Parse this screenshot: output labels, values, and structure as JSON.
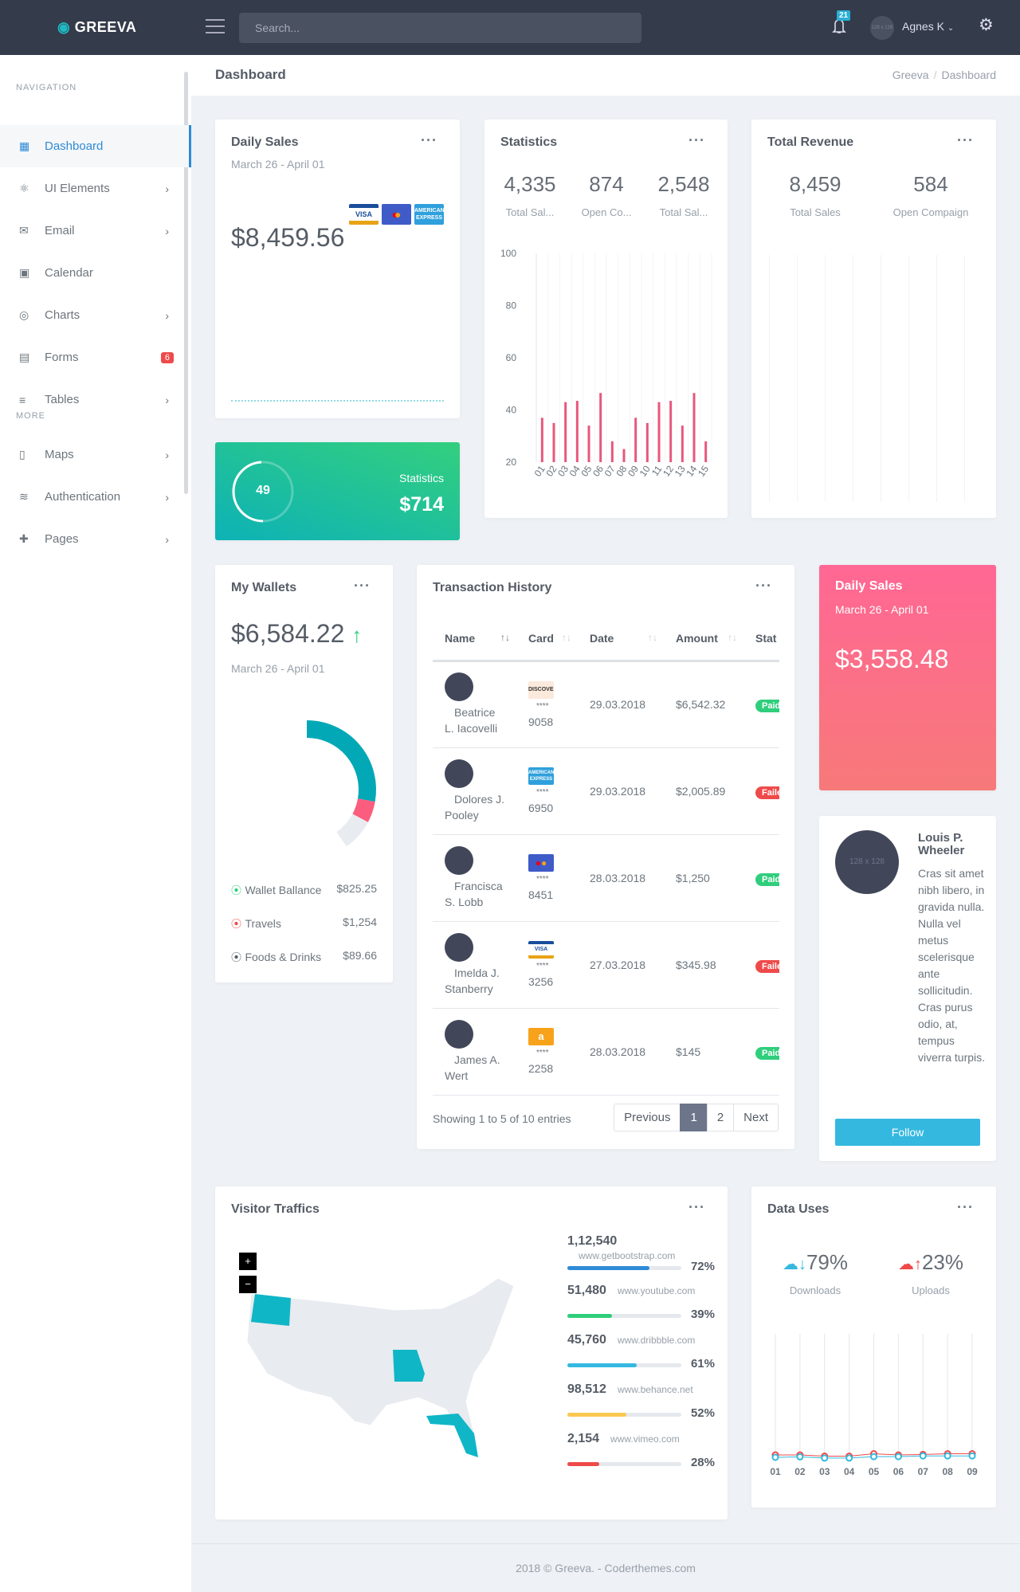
{
  "header": {
    "logo": "GREEVA",
    "search_placeholder": "Search...",
    "notifications": "21",
    "user": "Agnes K",
    "avatar_text": "128 x 128"
  },
  "sidebar": {
    "section_nav": "NAVIGATION",
    "section_more": "MORE",
    "items": [
      {
        "label": "Dashboard",
        "icon": "dashboard-icon",
        "active": true
      },
      {
        "label": "UI Elements",
        "icon": "atom-icon",
        "chevron": true
      },
      {
        "label": "Email",
        "icon": "mail-icon",
        "chevron": true
      },
      {
        "label": "Calendar",
        "icon": "calendar-icon"
      },
      {
        "label": "Charts",
        "icon": "chart-donut-icon",
        "chevron": true
      },
      {
        "label": "Forms",
        "icon": "form-icon",
        "badge": "6"
      },
      {
        "label": "Tables",
        "icon": "filter-icon",
        "chevron": true
      },
      {
        "label": "Maps",
        "icon": "map-icon",
        "chevron": true
      },
      {
        "label": "Authentication",
        "icon": "layers-icon",
        "chevron": true
      },
      {
        "label": "Pages",
        "icon": "puzzle-icon",
        "chevron": true
      }
    ]
  },
  "page": {
    "title": "Dashboard",
    "breadcrumb": [
      "Greeva",
      "Dashboard"
    ]
  },
  "daily_sales": {
    "title": "Daily Sales",
    "range": "March 26 - April 01",
    "amount": "$8,459.56",
    "cards": [
      "VISA",
      "mastercard",
      "AMERICAN EXPRESS"
    ]
  },
  "green_stat": {
    "value": "49",
    "progress": 49,
    "label": "Statistics",
    "amount": "$714"
  },
  "statistics": {
    "title": "Statistics",
    "stats": [
      {
        "value": "4,335",
        "label": "Total Sal..."
      },
      {
        "value": "874",
        "label": "Open Co..."
      },
      {
        "value": "2,548",
        "label": "Total Sal..."
      }
    ]
  },
  "total_revenue": {
    "title": "Total Revenue",
    "stats": [
      {
        "value": "8,459",
        "label": "Total Sales"
      },
      {
        "value": "584",
        "label": "Open Compaign"
      }
    ]
  },
  "wallets": {
    "title": "My Wallets",
    "amount": "$6,584.22",
    "range": "March 26 - April 01",
    "items": [
      {
        "label": "Wallet Ballance",
        "value": "$825.25",
        "color": "#2fce7c"
      },
      {
        "label": "Travels",
        "value": "$1,254",
        "color": "#ef4a4a"
      },
      {
        "label": "Foods & Drinks",
        "value": "$89.66",
        "color": "#555c66"
      }
    ]
  },
  "transactions": {
    "title": "Transaction History",
    "columns": [
      "Name",
      "Card",
      "Date",
      "Amount",
      "Stat"
    ],
    "rows": [
      {
        "name1": "Beatrice",
        "name2": "L. Iacovelli",
        "card": "DISCOVER",
        "masked": "****",
        "last4": "9058",
        "date": "29.03.2018",
        "amount": "$6,542.32",
        "status": "Paid"
      },
      {
        "name1": "Dolores J.",
        "name2": "Pooley",
        "card": "AMERICAN EXPRESS",
        "masked": "****",
        "last4": "6950",
        "date": "29.03.2018",
        "amount": "$2,005.89",
        "status": "Failed"
      },
      {
        "name1": "Francisca",
        "name2": "S. Lobb",
        "card": "mastercard",
        "masked": "****",
        "last4": "8451",
        "date": "28.03.2018",
        "amount": "$1,250",
        "status": "Paid"
      },
      {
        "name1": "Imelda J.",
        "name2": "Stanberry",
        "card": "VISA",
        "masked": "****",
        "last4": "3256",
        "date": "27.03.2018",
        "amount": "$345.98",
        "status": "Failed"
      },
      {
        "name1": "James A.",
        "name2": "Wert",
        "card": "a",
        "masked": "****",
        "last4": "2258",
        "date": "28.03.2018",
        "amount": "$145",
        "status": "Paid"
      }
    ],
    "info": "Showing 1 to 5 of 10 entries",
    "pagination": {
      "prev": "Previous",
      "pages": [
        "1",
        "2"
      ],
      "current": "1",
      "next": "Next"
    }
  },
  "pink_sales": {
    "title": "Daily Sales",
    "range": "March 26 - April 01",
    "amount": "$3,558.48"
  },
  "profile": {
    "avatar_text": "128 x 128",
    "name": "Louis P. Wheeler",
    "bio": "Cras sit amet nibh libero, in gravida nulla. Nulla vel metus scelerisque ante sollicitudin. Cras purus odio, at, tempus viverra turpis.",
    "follow": "Follow"
  },
  "visitors": {
    "title": "Visitor Traffics",
    "zoom_in": "+",
    "zoom_out": "−",
    "highlighted_states": [
      "Oregon",
      "Missouri",
      "Florida"
    ],
    "items": [
      {
        "count": "1,12,540",
        "url": "www.getbootstrap.com",
        "percent": 72,
        "pct_label": "72%",
        "color": "#2e8bd6"
      },
      {
        "count": "51,480",
        "url": "www.youtube.com",
        "percent": 39,
        "pct_label": "39%",
        "color": "#2fce7c"
      },
      {
        "count": "45,760",
        "url": "www.dribbble.com",
        "percent": 61,
        "pct_label": "61%",
        "color": "#35b8e0"
      },
      {
        "count": "98,512",
        "url": "www.behance.net",
        "percent": 52,
        "pct_label": "52%",
        "color": "#f9c851"
      },
      {
        "count": "2,154",
        "url": "www.vimeo.com",
        "percent": 28,
        "pct_label": "28%",
        "color": "#ef4a4a"
      }
    ]
  },
  "data_uses": {
    "title": "Data Uses",
    "downloads": {
      "value": "79%",
      "label": "Downloads",
      "color": "#35b8e0"
    },
    "uploads": {
      "value": "23%",
      "label": "Uploads",
      "color": "#ef4a4a"
    }
  },
  "footer": {
    "text": "2018 © Greeva. - Coderthemes.com"
  },
  "chart_data": [
    {
      "type": "bar",
      "categories": [
        "01",
        "02",
        "03",
        "04",
        "05",
        "06",
        "07",
        "08",
        "09",
        "10",
        "11",
        "12",
        "13",
        "14",
        "15"
      ],
      "values": [
        37,
        35,
        43,
        43.5,
        34,
        46.5,
        28,
        25,
        37,
        35,
        43,
        43.5,
        34,
        46.5,
        28
      ],
      "ylim": [
        20,
        100
      ],
      "yticks": [
        "100",
        "80",
        "60",
        "40",
        "20"
      ],
      "grid": true,
      "color": "#e8577c"
    },
    {
      "type": "line",
      "categories": [
        "01",
        "02",
        "03",
        "04",
        "05",
        "06",
        "07",
        "08",
        "09"
      ],
      "series": [
        {
          "values": [
            1,
            1,
            0.5,
            0.5,
            1.5,
            1,
            1.2,
            1.5,
            1.5
          ],
          "color": "#ef4a4a"
        },
        {
          "values": [
            0,
            0.2,
            -0.3,
            -0.3,
            0.3,
            0.3,
            0.6,
            0.6,
            0.6
          ],
          "color": "#35b8e0"
        }
      ],
      "grid": true
    },
    {
      "type": "pie",
      "values": [
        100,
        18,
        27
      ],
      "colors": [
        "#02a8b5",
        "#fc5c7d",
        "#e8ebef"
      ]
    }
  ]
}
